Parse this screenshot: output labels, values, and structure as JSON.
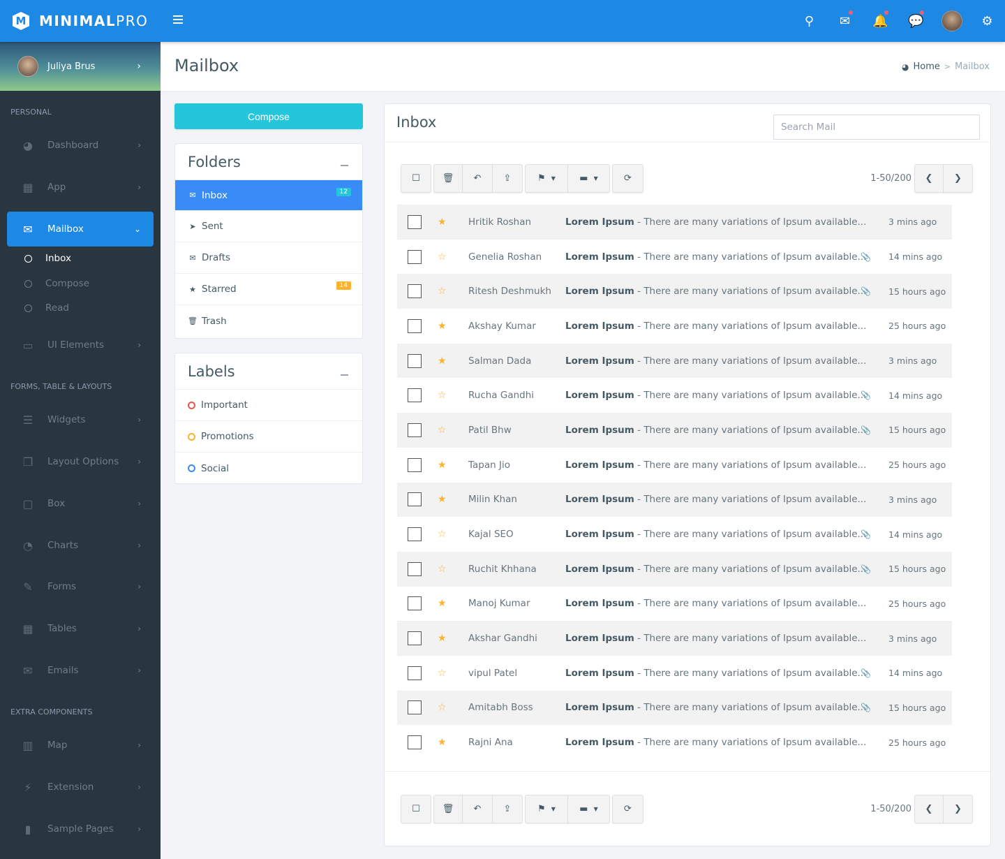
{
  "topbar": {
    "logo_bold": "MINIMAL",
    "logo_light": "PRO",
    "logo_mark": "M",
    "menu_icon": "hamburger-icon",
    "icons": [
      {
        "name": "search-icon",
        "glyph": "⚲",
        "dot": false
      },
      {
        "name": "mail-icon",
        "glyph": "✉",
        "dot": true
      },
      {
        "name": "bell-icon",
        "glyph": "🔔",
        "dot": true
      },
      {
        "name": "chat-icon",
        "glyph": "💬",
        "dot": true
      },
      {
        "name": "avatar",
        "glyph": "",
        "dot": false
      },
      {
        "name": "gear-icon",
        "glyph": "⚙",
        "dot": false
      }
    ],
    "accent": "#1e88e5"
  },
  "sidebar": {
    "user_name": "Juliya Brus",
    "user_chevron": "›",
    "sections": [
      {
        "title": "PERSONAL"
      },
      {
        "title": "FORMS, TABLE & LAYOUTS"
      },
      {
        "title": "EXTRA COMPONENTS"
      }
    ],
    "items": [
      {
        "label": "Dashboard",
        "icon": "◕",
        "chev": "›"
      },
      {
        "label": "App",
        "icon": "▦",
        "chev": "›"
      },
      {
        "label": "Mailbox",
        "icon": "✉",
        "chev": "⌄"
      },
      {
        "label": "UI Elements",
        "icon": "▭",
        "chev": "›"
      },
      {
        "label": "Widgets",
        "icon": "☰",
        "chev": "›"
      },
      {
        "label": "Layout Options",
        "icon": "❐",
        "chev": "›"
      },
      {
        "label": "Box",
        "icon": "▢",
        "chev": "›"
      },
      {
        "label": "Charts",
        "icon": "◔",
        "chev": "›"
      },
      {
        "label": "Forms",
        "icon": "✎",
        "chev": "›"
      },
      {
        "label": "Tables",
        "icon": "▦",
        "chev": "›"
      },
      {
        "label": "Emails",
        "icon": "✉",
        "chev": "›"
      },
      {
        "label": "Map",
        "icon": "▥",
        "chev": "›"
      },
      {
        "label": "Extension",
        "icon": "⚡",
        "chev": "›"
      },
      {
        "label": "Sample Pages",
        "icon": "▮",
        "chev": "›"
      }
    ],
    "mailbox_sub": [
      {
        "label": "Inbox"
      },
      {
        "label": "Compose"
      },
      {
        "label": "Read"
      }
    ]
  },
  "page": {
    "title": "Mailbox",
    "breadcrumb_icon": "◕",
    "breadcrumb_home": "Home",
    "breadcrumb_sep": ">",
    "breadcrumb_current": "Mailbox"
  },
  "left": {
    "compose_label": "Compose",
    "folders_title": "Folders",
    "folders": [
      {
        "label": "Inbox",
        "icon": "✉",
        "badge": "12",
        "badge_color": "#26c6da"
      },
      {
        "label": "Sent",
        "icon": "➤",
        "badge": "",
        "badge_color": ""
      },
      {
        "label": "Drafts",
        "icon": "✉",
        "badge": "",
        "badge_color": ""
      },
      {
        "label": "Starred",
        "icon": "★",
        "badge": "14",
        "badge_color": "#ffb22b"
      },
      {
        "label": "Trash",
        "icon": "🗑",
        "badge": "",
        "badge_color": ""
      }
    ],
    "labels_title": "Labels",
    "labels": [
      {
        "label": "Important",
        "color": "#ef5350"
      },
      {
        "label": "Promotions",
        "color": "#ffb22b"
      },
      {
        "label": "Social",
        "color": "#398bf7"
      }
    ]
  },
  "inbox": {
    "title": "Inbox",
    "search_placeholder": "Search Mail",
    "pager_text": "1-50/200",
    "toolbar": {
      "select": "☐",
      "delete": "🗑",
      "reply": "↶",
      "share": "⇪",
      "flag": "⚑",
      "folder": "▬",
      "refresh": "⟳",
      "caret": "▼",
      "prev": "❮",
      "next": "❯"
    },
    "subject_bold": "Lorem Ipsum",
    "subject_rest": " - There are many variations of Ipsum available...",
    "emails": [
      {
        "sender": "Hritik Roshan",
        "starred": true,
        "attachment": false,
        "time": "3 mins ago"
      },
      {
        "sender": "Genelia Roshan",
        "starred": false,
        "attachment": true,
        "time": "14 mins ago"
      },
      {
        "sender": "Ritesh Deshmukh",
        "starred": false,
        "attachment": true,
        "time": "15 hours ago"
      },
      {
        "sender": "Akshay Kumar",
        "starred": true,
        "attachment": false,
        "time": "25 hours ago"
      },
      {
        "sender": "Salman Dada",
        "starred": true,
        "attachment": false,
        "time": "3 mins ago"
      },
      {
        "sender": "Rucha Gandhi",
        "starred": false,
        "attachment": true,
        "time": "14 mins ago"
      },
      {
        "sender": "Patil Bhw",
        "starred": false,
        "attachment": true,
        "time": "15 hours ago"
      },
      {
        "sender": "Tapan Jio",
        "starred": true,
        "attachment": false,
        "time": "25 hours ago"
      },
      {
        "sender": "Milin Khan",
        "starred": true,
        "attachment": false,
        "time": "3 mins ago"
      },
      {
        "sender": "Kajal SEO",
        "starred": false,
        "attachment": true,
        "time": "14 mins ago"
      },
      {
        "sender": "Ruchit Khhana",
        "starred": false,
        "attachment": true,
        "time": "15 hours ago"
      },
      {
        "sender": "Manoj Kumar",
        "starred": true,
        "attachment": false,
        "time": "25 hours ago"
      },
      {
        "sender": "Akshar Gandhi",
        "starred": true,
        "attachment": false,
        "time": "3 mins ago"
      },
      {
        "sender": "vipul Patel",
        "starred": false,
        "attachment": true,
        "time": "14 mins ago"
      },
      {
        "sender": "Amitabh Boss",
        "starred": false,
        "attachment": true,
        "time": "15 hours ago"
      },
      {
        "sender": "Rajni Ana",
        "starred": true,
        "attachment": false,
        "time": "25 hours ago"
      }
    ]
  }
}
